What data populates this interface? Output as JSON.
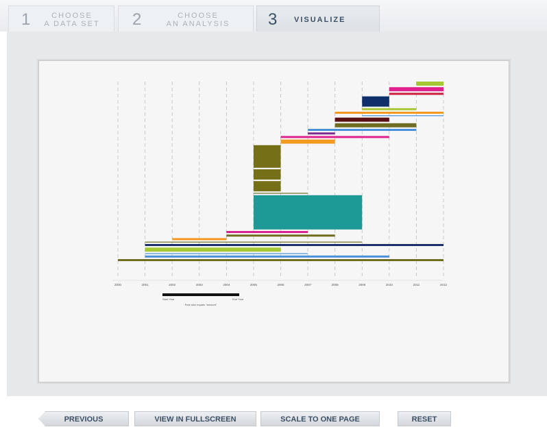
{
  "tabs": [
    {
      "number": "1",
      "label_line1": "CHOOSE",
      "label_line2": "A DATA SET"
    },
    {
      "number": "2",
      "label_line1": "CHOOSE",
      "label_line2": "AN ANALYSIS"
    },
    {
      "number": "3",
      "label": "VISUALIZE"
    }
  ],
  "buttons": {
    "previous": "PREVIOUS",
    "fullscreen": "VIEW IN FULLSCREEN",
    "scale": "SCALE TO ONE PAGE",
    "reset": "RESET"
  },
  "chart_data": {
    "type": "bar",
    "x_ticks": [
      "2000",
      "2001",
      "2002",
      "2003",
      "2004",
      "2005",
      "2006",
      "2007",
      "2008",
      "2009",
      "2010",
      "2011",
      "2012"
    ],
    "xlim": [
      2000,
      2012
    ],
    "grid": true,
    "legend": {
      "start_label": "Start Year",
      "end_label": "End Year",
      "note": "Row size equals \"amount\""
    },
    "bars": [
      {
        "start": 2011.0,
        "end": 2012.0,
        "color": "#a6c832",
        "thickness": "medium"
      },
      {
        "start": 2010.0,
        "end": 2012.0,
        "color": "#e0228f",
        "thickness": "medium"
      },
      {
        "start": 2010.0,
        "end": 2012.0,
        "color": "#c81e3c",
        "thickness": "thin"
      },
      {
        "start": 2009.0,
        "end": 2010.0,
        "color": "#0f2f6b",
        "thickness": "large"
      },
      {
        "start": 2009.0,
        "end": 2011.0,
        "color": "#a6c832",
        "thickness": "thin"
      },
      {
        "start": 2008.0,
        "end": 2012.0,
        "color": "#f39a1e",
        "thickness": "thin"
      },
      {
        "start": 2009.0,
        "end": 2012.0,
        "color": "#4a90d9",
        "thickness": "hair"
      },
      {
        "start": 2008.0,
        "end": 2010.0,
        "color": "#5a0f12",
        "thickness": "medium"
      },
      {
        "start": 2008.0,
        "end": 2011.0,
        "color": "#6f6d21",
        "thickness": "medium"
      },
      {
        "start": 2007.0,
        "end": 2011.0,
        "color": "#4a90d9",
        "thickness": "thin"
      },
      {
        "start": 2007.0,
        "end": 2008.0,
        "color": "#7b2d8f",
        "thickness": "thin"
      },
      {
        "start": 2006.0,
        "end": 2010.0,
        "color": "#e0228f",
        "thickness": "thin"
      },
      {
        "start": 2006.0,
        "end": 2008.0,
        "color": "#f39a1e",
        "thickness": "medium"
      },
      {
        "start": 2005.0,
        "end": 2006.0,
        "color": "#757018",
        "thickness": "xlarge"
      },
      {
        "start": 2005.0,
        "end": 2006.0,
        "color": "#757018",
        "thickness": "large"
      },
      {
        "start": 2005.0,
        "end": 2006.0,
        "color": "#757018",
        "thickness": "large"
      },
      {
        "start": 2005.0,
        "end": 2007.0,
        "color": "#6f6d21",
        "thickness": "hair"
      },
      {
        "start": 2005.0,
        "end": 2009.0,
        "color": "#1e9a96",
        "thickness": "xxlarge"
      },
      {
        "start": 2004.0,
        "end": 2007.0,
        "color": "#d6228f",
        "thickness": "thin"
      },
      {
        "start": 2004.0,
        "end": 2008.0,
        "color": "#6f6d21",
        "thickness": "thin"
      },
      {
        "start": 2002.0,
        "end": 2004.0,
        "color": "#f39a1e",
        "thickness": "thin"
      },
      {
        "start": 2001.0,
        "end": 2009.0,
        "color": "#6f6d21",
        "thickness": "hair"
      },
      {
        "start": 2001.0,
        "end": 2012.0,
        "color": "#1b2f6b",
        "thickness": "thin"
      },
      {
        "start": 2001.0,
        "end": 2006.0,
        "color": "#a6c832",
        "thickness": "medium"
      },
      {
        "start": 2001.0,
        "end": 2007.0,
        "color": "#4a90d9",
        "thickness": "hair"
      },
      {
        "start": 2001.0,
        "end": 2010.0,
        "color": "#4a90d9",
        "thickness": "thin"
      },
      {
        "start": 2000.0,
        "end": 2012.0,
        "color": "#6f6d21",
        "thickness": "thin"
      }
    ]
  }
}
